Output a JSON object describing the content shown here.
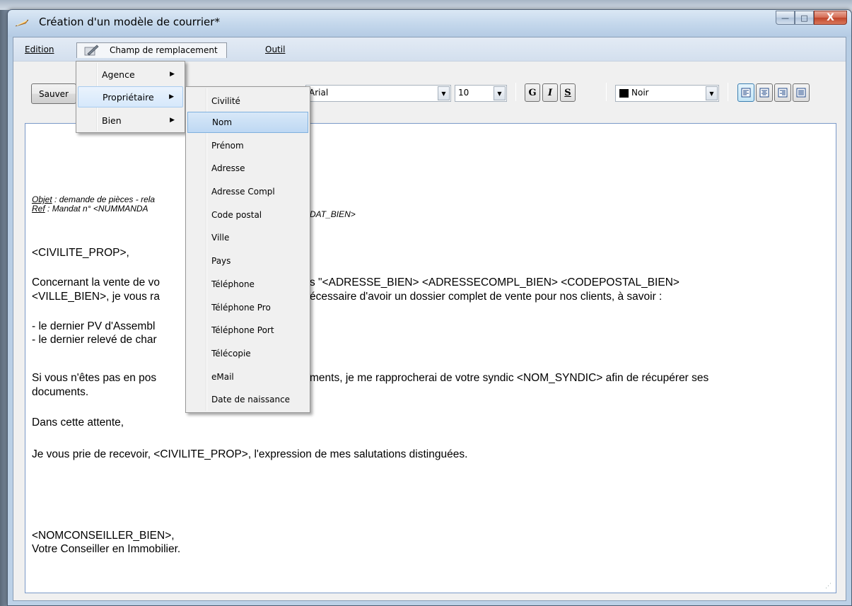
{
  "window": {
    "title": "Création d'un modèle de courrier*",
    "minimize_glyph": "—",
    "maximize_glyph": "□",
    "close_glyph": "X"
  },
  "menubar": {
    "edition": "Edition",
    "champ": "Champ de remplacement",
    "outil": "Outil"
  },
  "toolbar": {
    "save_label": "Sauver",
    "font_name": "Arial",
    "font_size": "10",
    "bold_label": "G",
    "italic_label": "I",
    "underline_label": "S",
    "color_name": "Noir",
    "color_swatch": "#000000"
  },
  "champ_menu": {
    "items": [
      {
        "label": "Agence",
        "has_submenu": true
      },
      {
        "label": "Propriétaire",
        "has_submenu": true,
        "highlighted": true
      },
      {
        "label": "Bien",
        "has_submenu": true
      }
    ]
  },
  "proprietaire_submenu": {
    "items": [
      {
        "label": "Civilité"
      },
      {
        "label": "Nom",
        "highlighted": true
      },
      {
        "label": "Prénom"
      },
      {
        "label": "Adresse"
      },
      {
        "label": "Adresse Compl"
      },
      {
        "label": "Code postal"
      },
      {
        "label": "Ville"
      },
      {
        "label": "Pays"
      },
      {
        "label": "Téléphone"
      },
      {
        "label": "Téléphone Pro"
      },
      {
        "label": "Téléphone Port"
      },
      {
        "label": "Télécopie"
      },
      {
        "label": "eMail"
      },
      {
        "label": "Date de naissance"
      }
    ]
  },
  "document": {
    "objet_prefix": "Objet",
    "objet_rest": " : demande de pièces - rela",
    "ref_prefix": "Ref",
    "ref_rest": "  : Mandat n° <NUMMANDA",
    "ref_tail": "DAT_BIEN>",
    "civilite": "<CIVILITE_PROP>,",
    "para1_line1_a": "Concernant la vente de vo",
    "para1_line1_b": "s \"<ADRESSE_BIEN> <ADRESSECOMPL_BIEN> <CODEPOSTAL_BIEN>",
    "para1_line2_a": "<VILLE_BIEN>, je vous ra",
    "para1_line2_b": "écessaire d'avoir un dossier complet de vente pour nos clients, à savoir :",
    "list1": "- le dernier PV d'Assembl",
    "list2": "- le dernier relevé de char",
    "para2_line1_a": "Si vous n'êtes pas en pos",
    "para2_line1_b": "ments, je me rapprocherai de votre syndic <NOM_SYNDIC> afin de récupérer ses",
    "para2_line2": "documents.",
    "attente": "Dans cette attente,",
    "salutations": "Je vous prie de recevoir, <CIVILITE_PROP>, l'expression de mes salutations distinguées.",
    "conseiller": "<NOMCONSEILLER_BIEN>,",
    "signature": "Votre Conseiller en Immobilier."
  },
  "colors": {
    "menu_highlight": "#d6e8fb",
    "editor_border": "#7a99c8",
    "titlebar": "#c5d8ec"
  },
  "icons": [
    "app-feather-icon",
    "menu-pen-icon",
    "chevron-right-icon",
    "dropdown-arrow-icon",
    "align-left-icon",
    "align-center-icon",
    "align-right-icon",
    "justify-icon"
  ]
}
